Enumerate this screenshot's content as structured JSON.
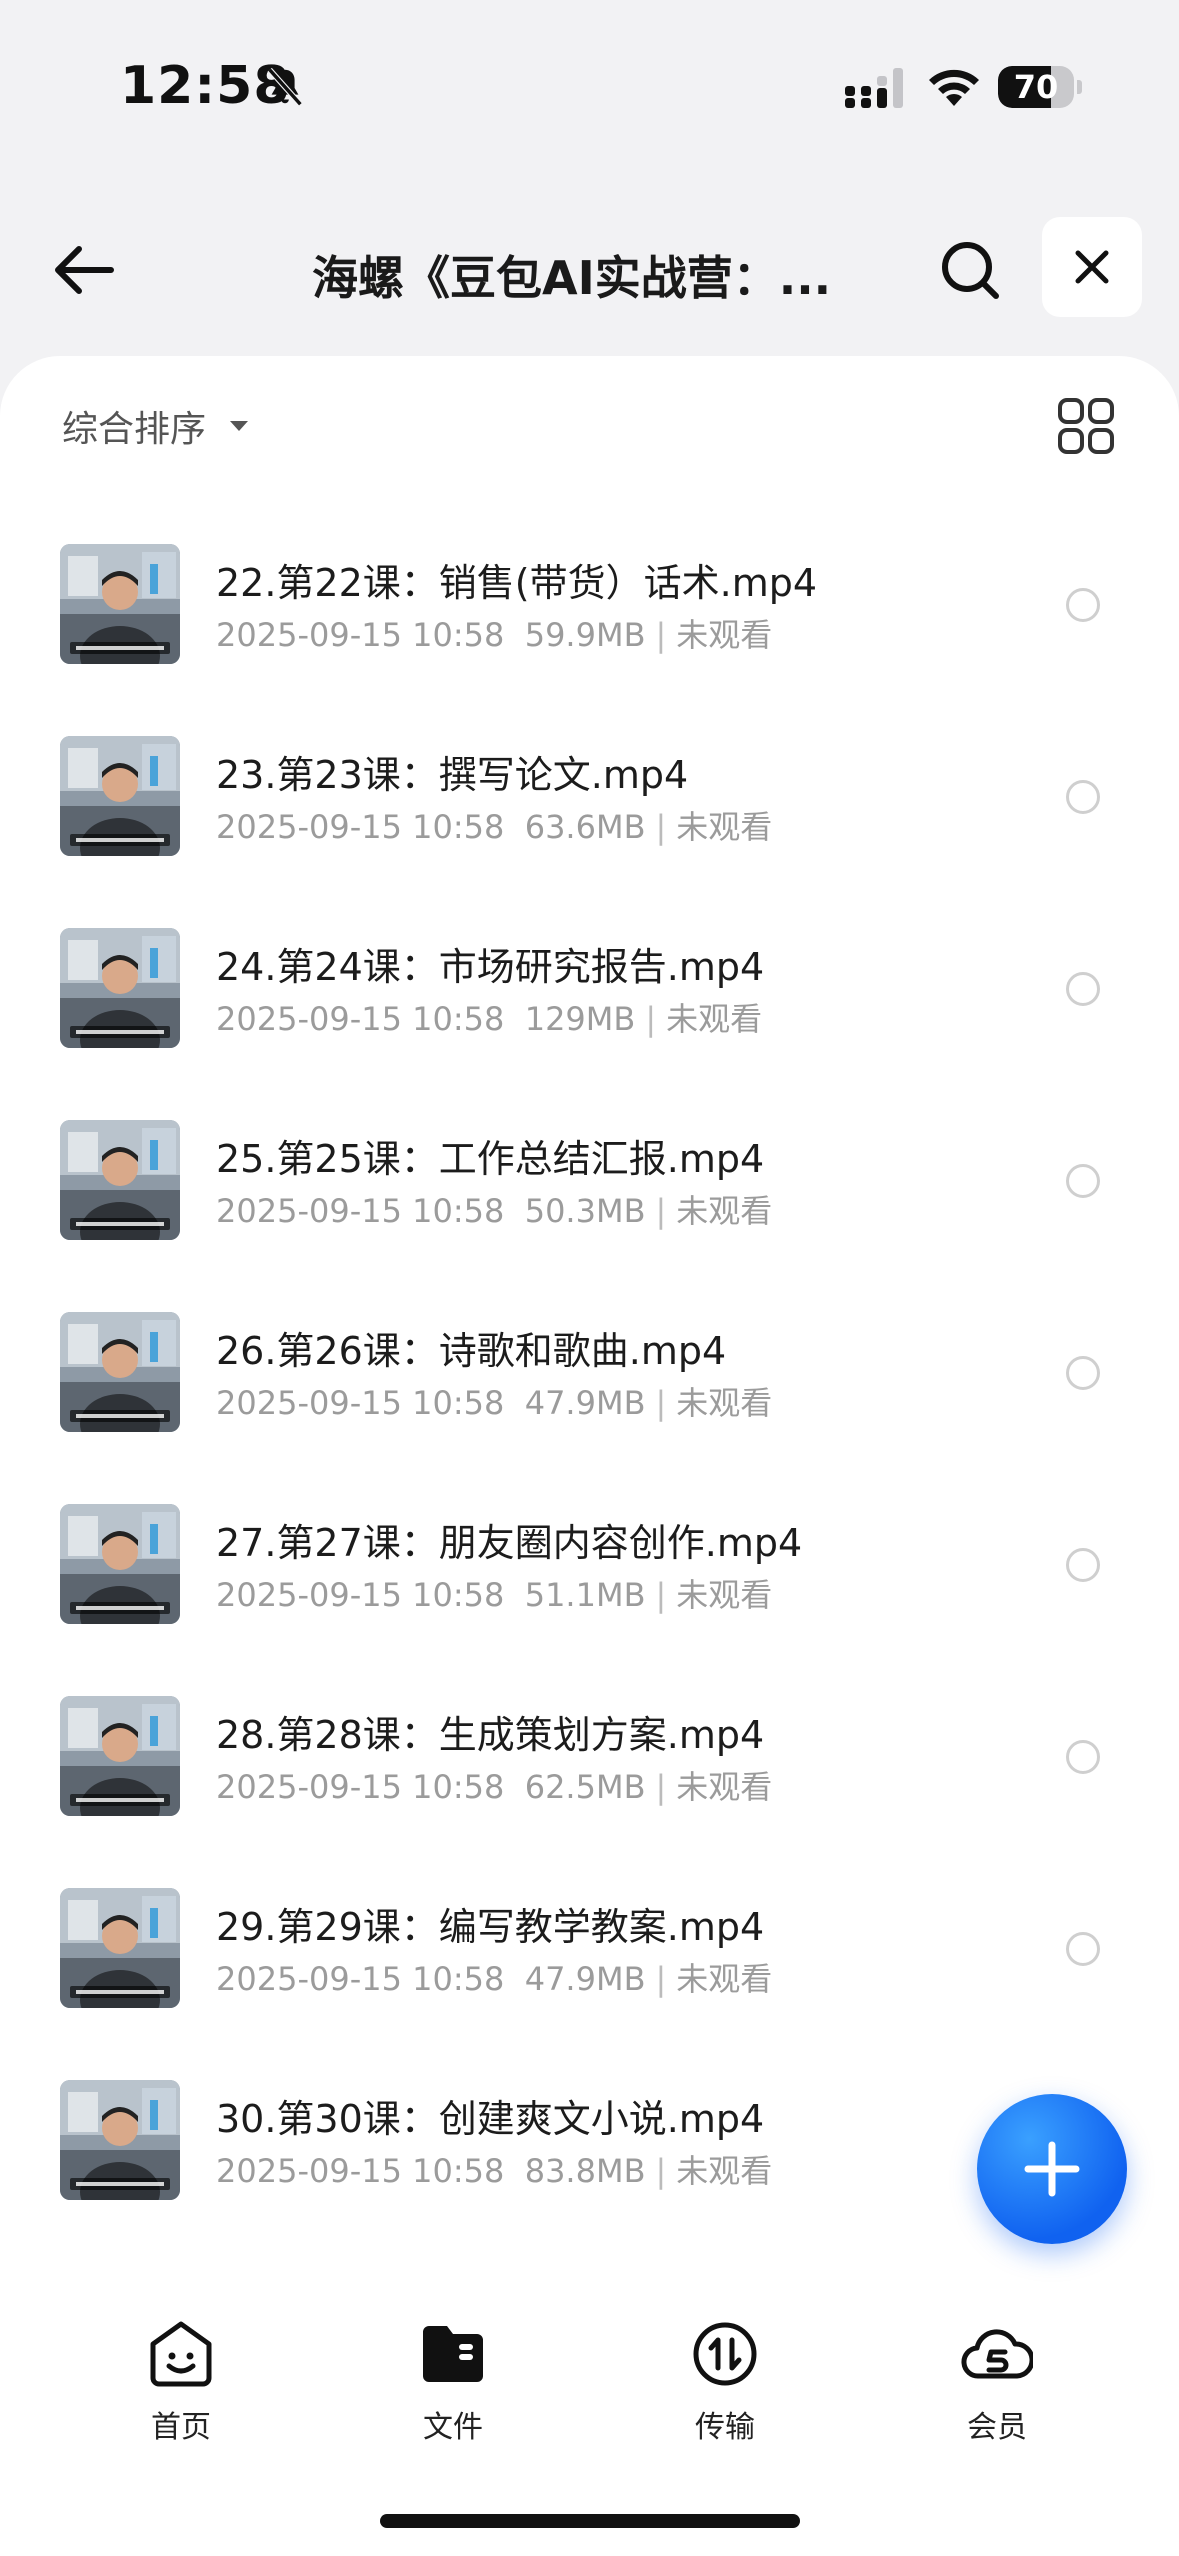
{
  "status_bar": {
    "time": "12:58",
    "battery": "70",
    "battery_level": 0.7
  },
  "header": {
    "title": "海螺《豆包AI实战营：..."
  },
  "toolbar": {
    "sort_label": "综合排序"
  },
  "files": [
    {
      "name": "22.第22课：销售(带货）话术.mp4",
      "date": "2025-09-15 10:58",
      "size": "59.9MB",
      "status": "未观看"
    },
    {
      "name": "23.第23课：撰写论文.mp4",
      "date": "2025-09-15 10:58",
      "size": "63.6MB",
      "status": "未观看"
    },
    {
      "name": "24.第24课：市场研究报告.mp4",
      "date": "2025-09-15 10:58",
      "size": "129MB",
      "status": "未观看"
    },
    {
      "name": "25.第25课：工作总结汇报.mp4",
      "date": "2025-09-15 10:58",
      "size": "50.3MB",
      "status": "未观看"
    },
    {
      "name": "26.第26课：诗歌和歌曲.mp4",
      "date": "2025-09-15 10:58",
      "size": "47.9MB",
      "status": "未观看"
    },
    {
      "name": "27.第27课：朋友圈内容创作.mp4",
      "date": "2025-09-15 10:58",
      "size": "51.1MB",
      "status": "未观看"
    },
    {
      "name": "28.第28课：生成策划方案.mp4",
      "date": "2025-09-15 10:58",
      "size": "62.5MB",
      "status": "未观看"
    },
    {
      "name": "29.第29课：编写教学教案.mp4",
      "date": "2025-09-15 10:58",
      "size": "47.9MB",
      "status": "未观看"
    },
    {
      "name": "30.第30课：创建爽文小说.mp4",
      "date": "2025-09-15 10:58",
      "size": "83.8MB",
      "status": "未观看"
    },
    {
      "name": "",
      "date": "",
      "size": "",
      "status": ""
    }
  ],
  "tabs": [
    {
      "label": "首页",
      "icon": "smiley-icon"
    },
    {
      "label": "文件",
      "icon": "folder-icon"
    },
    {
      "label": "传输",
      "icon": "transfer-icon"
    },
    {
      "label": "会员",
      "icon": "cloud-vip-icon"
    }
  ],
  "colors": {
    "accent": "#1062f0",
    "text": "#1c1c1c",
    "meta": "#9b9b9b"
  }
}
